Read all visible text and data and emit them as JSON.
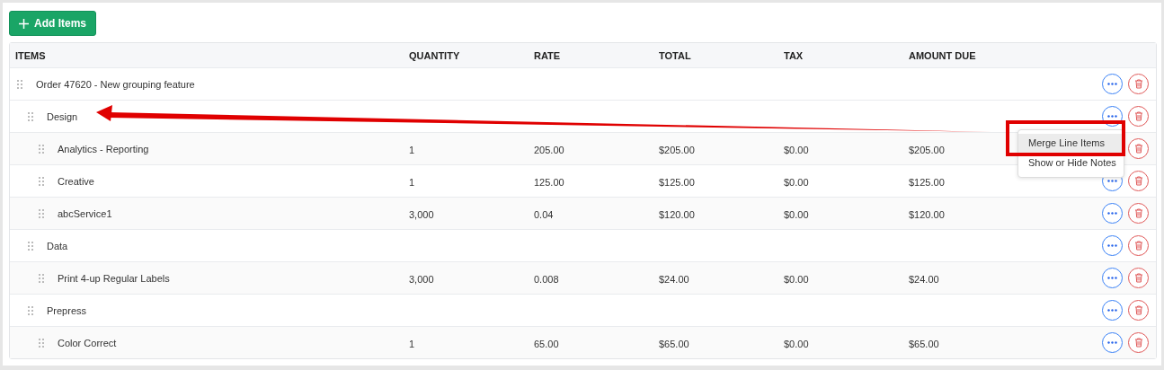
{
  "add_button": {
    "label": "Add Items"
  },
  "table": {
    "columns": [
      "ITEMS",
      "QUANTITY",
      "RATE",
      "TOTAL",
      "TAX",
      "AMOUNT DUE"
    ],
    "rows": [
      {
        "name": "Order 47620 - New grouping feature",
        "children": [
          {
            "name": "Design",
            "children": [
              {
                "name": "Analytics - Reporting",
                "options_visible": false,
                "quantity": "1",
                "rate": "205.00",
                "total": "$205.00",
                "tax": "$0.00",
                "amount_due": "$205.00"
              },
              {
                "name": "Creative",
                "quantity": "1",
                "rate": "125.00",
                "total": "$125.00",
                "tax": "$0.00",
                "amount_due": "$125.00"
              },
              {
                "name": "abcService1",
                "quantity": "3,000",
                "rate": "0.04",
                "total": "$120.00",
                "tax": "$0.00",
                "amount_due": "$120.00"
              }
            ]
          },
          {
            "name": "Data",
            "children": [
              {
                "name": "Print 4-up Regular Labels",
                "quantity": "3,000",
                "rate": "0.008",
                "total": "$24.00",
                "tax": "$0.00",
                "amount_due": "$24.00"
              }
            ]
          },
          {
            "name": "Prepress",
            "children": [
              {
                "name": "Color Correct",
                "quantity": "1",
                "rate": "65.00",
                "total": "$65.00",
                "tax": "$0.00",
                "amount_due": "$65.00"
              }
            ]
          }
        ]
      }
    ]
  },
  "row_menu": {
    "items": [
      {
        "label": "Merge Line Items",
        "highlighted": true
      },
      {
        "label": "Show or Hide Notes",
        "highlighted": false
      }
    ]
  }
}
